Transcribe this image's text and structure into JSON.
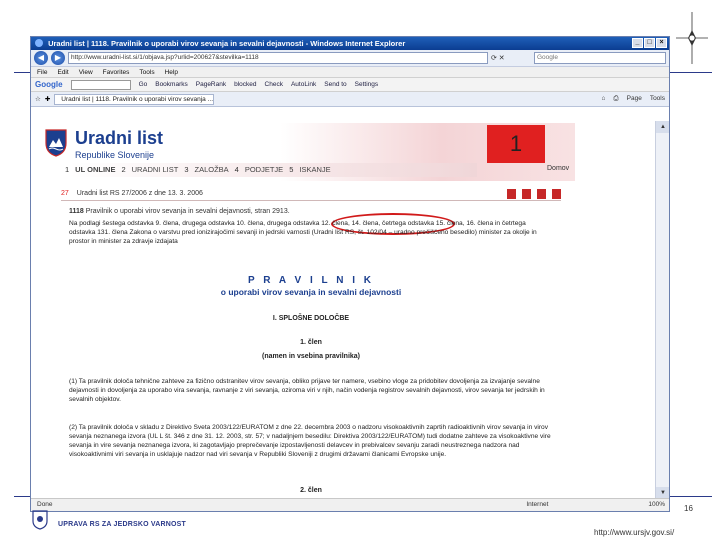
{
  "browser": {
    "title": "Uradni list | 1118. Pravilnik o uporabi virov sevanja in sevalni dejavnosti - Windows Internet Explorer",
    "url": "http://www.uradni-list.si/1/objava.jsp?urlid=200627&stevilka=1118",
    "search_placeholder": "Google",
    "menu": [
      "File",
      "Edit",
      "View",
      "Favorites",
      "Tools",
      "Help"
    ],
    "google_items": [
      "Google",
      "Go",
      "Bookmarks",
      "PageRank",
      "blocked",
      "Check",
      "AutoLink",
      "Send to",
      "Settings"
    ],
    "tab_title": "Uradni list | 1118. Pravilnik o uporabi virov sevanja ...",
    "tab_tools": [
      "Page",
      "Tools"
    ],
    "status_done": "Done",
    "status_zone": "Internet",
    "status_zoom": "100%"
  },
  "site": {
    "title": "Uradni list",
    "subtitle": "Republike Slovenije",
    "badge": "1",
    "domov": "Domov",
    "nav": [
      {
        "num": "1",
        "label": "UL ONLINE"
      },
      {
        "num": "2",
        "label": "URADNI LIST"
      },
      {
        "num": "3",
        "label": "ZALOŽBA"
      },
      {
        "num": "4",
        "label": "PODJETJE"
      },
      {
        "num": "5",
        "label": "ISKANJE"
      }
    ]
  },
  "doc": {
    "issue_num": "27",
    "issue": "Uradni list RS 27/2006 z dne 13. 3. 2006",
    "meta_num": "1118",
    "meta": "Pravilnik o uporabi virov sevanja in sevalni dejavnosti, stran 2913.",
    "intro": "Na podlagi šestega odstavka 9. člena, drugega odstavka 10. člena, drugega odstavka 12. člena, 14. člena, četrtega odstavka 15. člena, 16. člena in četrtega odstavka 131. člena Zakona o varstvu pred ionizirajočimi sevanji in jedrski varnosti (Uradni list RS, št. 102/04 – uradno prečiščeno besedilo) minister za okolje in prostor in minister za zdravje izdajata",
    "title": "P R A V I   L N I K",
    "subtitle": "o uporabi virov sevanja in sevalni dejavnosti",
    "chapter": "I. SPLOŠNE DOLOČBE",
    "article1": "1. člen",
    "article1_sub": "(namen in vsebina pravilnika)",
    "p1": "(1) Ta pravilnik določa tehnične zahteve za fizično odstranitev virov sevanja, obliko prijave ter namere, vsebino vloge za pridobitev dovoljenja za izvajanje sevalne dejavnosti in dovoljenja za uporabo vira sevanja, ravnanje z viri sevanja, oziroma viri v njih, način vodenja registrov sevalnih dejavnosti, virov sevanja ter jedrskih in sevalnih objektov.",
    "p2": "(2) Ta pravilnik določa v skladu z Direktivo Sveta 2003/122/EURATOM z dne 22. decembra 2003 o nadzoru visokoaktivnih zaprtih radioaktivnih virov sevanja in virov sevanja neznanega izvora (UL L št. 346 z dne 31. 12. 2003, str. 57; v nadaljnjem besedilu: Direktiva 2003/122/EURATOM) tudi dodatne zahteve za visokoaktivne vire sevanja in vire sevanja neznanega izvora, ki zagotavljajo preprečevanje izpostavljenosti delavcev in prebivalcev sevanju zaradi neustreznega nadzora nad visokoaktivnimi viri sevanja in usklajuje nadzor nad viri sevanja v Republiki Sloveniji z drugimi državami članicami Evropske unije.",
    "article2": "2. člen"
  },
  "slide": {
    "page_number": "16",
    "org": "UPRAVA RS ZA JEDRSKO VARNOST",
    "url": "http://www.ursjv.gov.si/"
  },
  "colors": {
    "brand_blue": "#1c3f8f",
    "accent_red": "#e02020",
    "ellipse": "#d11a1a"
  }
}
